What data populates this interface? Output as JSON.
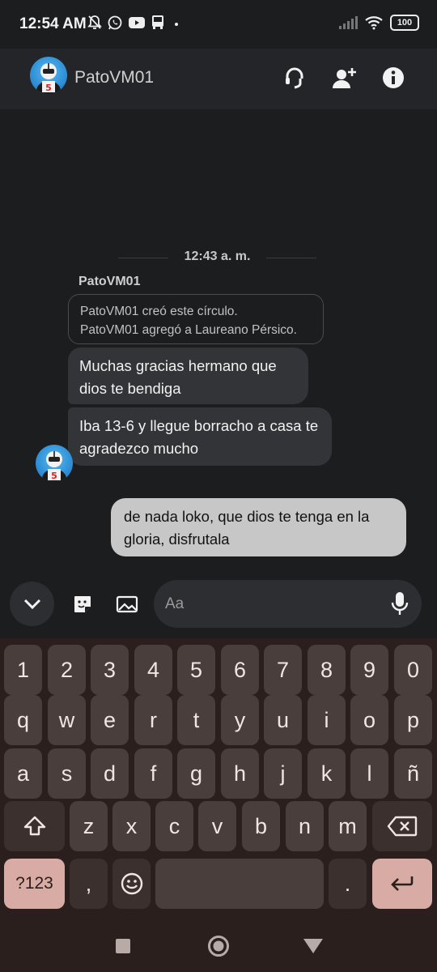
{
  "status_bar": {
    "time": "12:54 AM",
    "battery": "100",
    "left_icons": [
      "muted-bell-icon",
      "whatsapp-icon",
      "youtube-icon",
      "bus-icon",
      "dot-icon"
    ],
    "right_icons": [
      "signal-icon",
      "wifi-icon",
      "battery-icon"
    ]
  },
  "header": {
    "contact_name": "PatoVM01",
    "buttons": [
      "call-icon",
      "add-person-icon",
      "info-icon"
    ]
  },
  "chat": {
    "time_divider": "12:43 a. m.",
    "sender": "PatoVM01",
    "system_line1": "PatoVM01 creó este círculo.",
    "system_line2": "PatoVM01 agregó a Laureano Pérsico.",
    "incoming": [
      {
        "text": "Muchas gracias hermano que dios te bendiga"
      },
      {
        "text": "Iba 13-6 y llegue borracho a casa te agradezco mucho"
      }
    ],
    "outgoing": [
      {
        "text": "de nada loko, que dios te tenga en la gloria, disfrutala"
      }
    ]
  },
  "composer": {
    "placeholder": "Aa"
  },
  "keyboard": {
    "row1": [
      "1",
      "2",
      "3",
      "4",
      "5",
      "6",
      "7",
      "8",
      "9",
      "0"
    ],
    "row2": [
      "q",
      "w",
      "e",
      "r",
      "t",
      "y",
      "u",
      "i",
      "o",
      "p"
    ],
    "row3": [
      "a",
      "s",
      "d",
      "f",
      "g",
      "h",
      "j",
      "k",
      "l",
      "ñ"
    ],
    "row4": [
      "z",
      "x",
      "c",
      "v",
      "b",
      "n",
      "m"
    ],
    "symbols_key": "?123",
    "comma_key": ",",
    "period_key": "."
  },
  "colors": {
    "chat_bg": "#1c1d1f",
    "incoming_bubble": "#333437",
    "outgoing_bubble": "#c7c7c7",
    "keyboard_bg": "#2b1f1d",
    "key_accent": "#d8aca4"
  }
}
